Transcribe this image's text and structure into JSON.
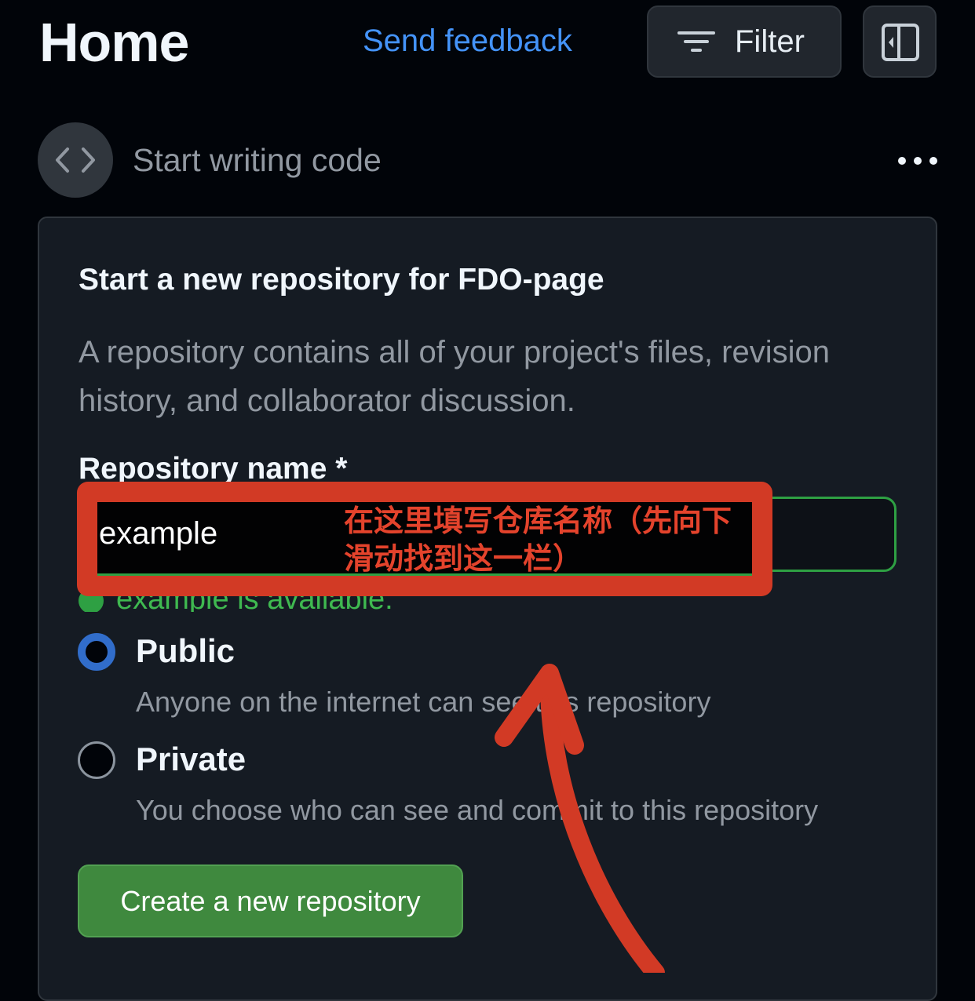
{
  "header": {
    "title": "Home",
    "feedback_link": "Send feedback",
    "filter_label": "Filter"
  },
  "section": {
    "title": "Start writing code"
  },
  "card": {
    "title": "Start a new repository for FDO-page",
    "description": "A repository contains all of your project's files, revision history, and collaborator discussion.",
    "repo_name_label": "Repository name *",
    "repo_name_value": "example",
    "availability_text": "example is available.",
    "options": [
      {
        "label": "Public",
        "description": "Anyone on the internet can see this repository",
        "selected": true
      },
      {
        "label": "Private",
        "description": "You choose who can see and commit to this repository",
        "selected": false
      }
    ],
    "create_button": "Create a new repository"
  },
  "annotation": {
    "text": "在这里填写仓库名称（先向下滑动找到这一栏）",
    "color": "#d23a25"
  },
  "colors": {
    "background": "#010409",
    "link": "#4493f8",
    "success": "#2ea043",
    "radio_selected": "#316dca",
    "primary_button": "#3f893e"
  }
}
